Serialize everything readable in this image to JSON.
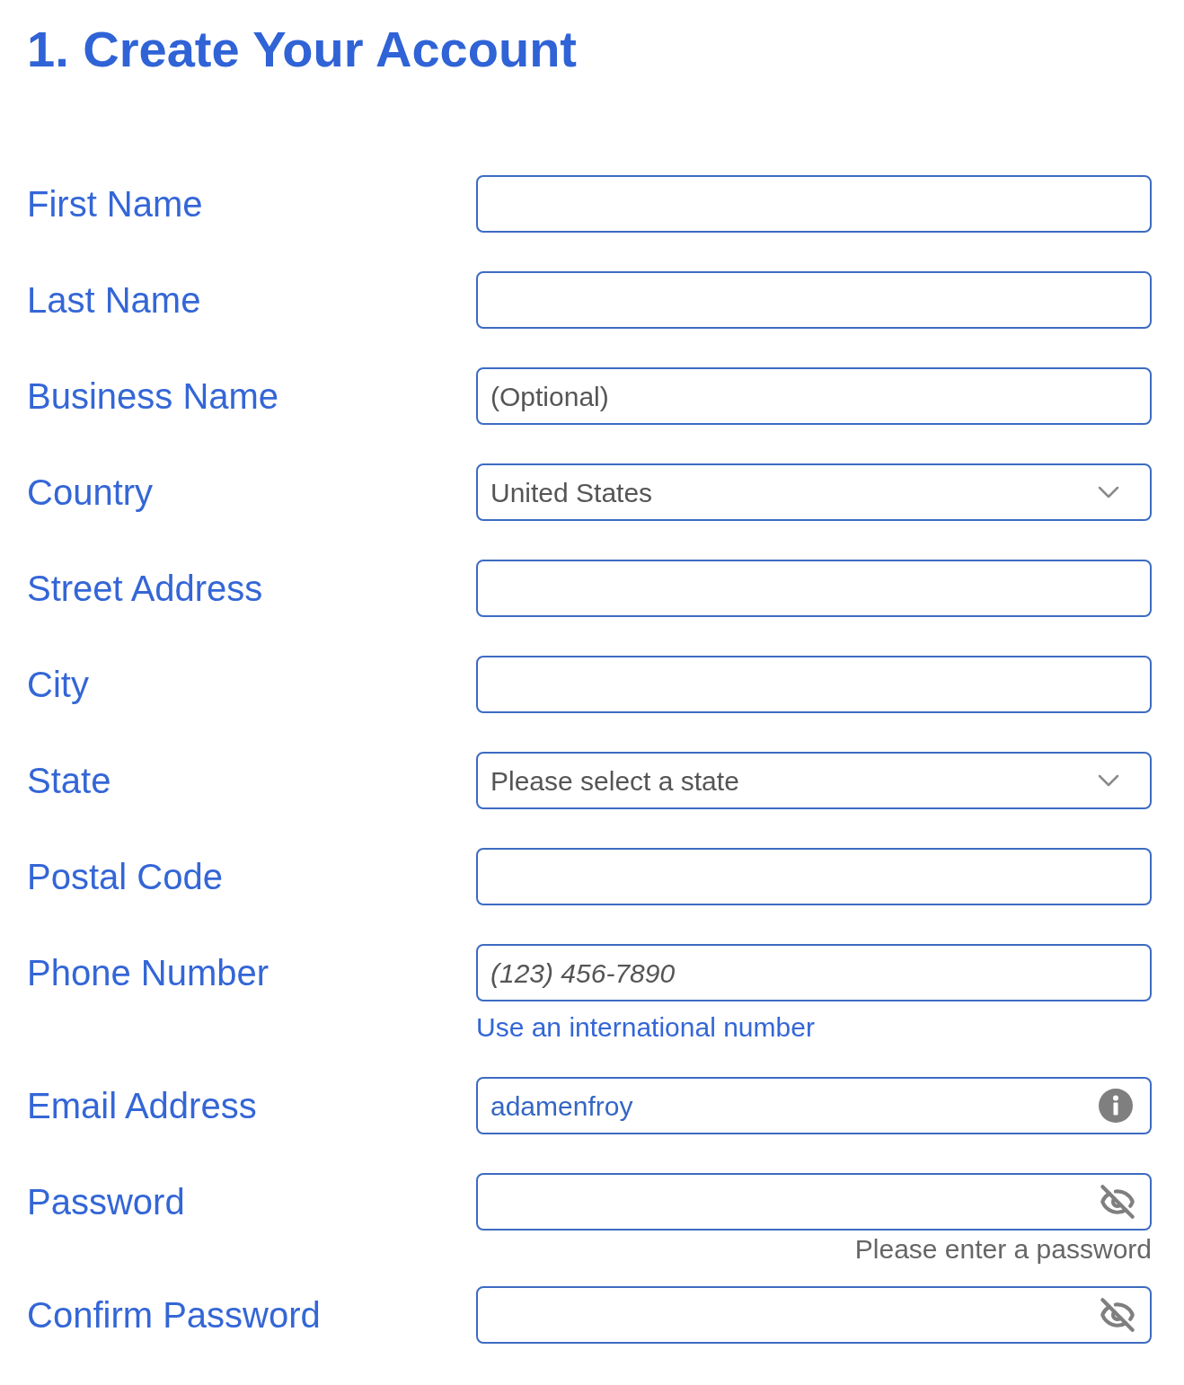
{
  "title": "1. Create Your Account",
  "fields": [
    {
      "label": "First Name",
      "kind": "text"
    },
    {
      "label": "Last Name",
      "kind": "text"
    },
    {
      "label": "Business Name",
      "kind": "text",
      "placeholder": "(Optional)"
    },
    {
      "label": "Country",
      "kind": "select",
      "value": "United States"
    },
    {
      "label": "Street Address",
      "kind": "text"
    },
    {
      "label": "City",
      "kind": "text"
    },
    {
      "label": "State",
      "kind": "select",
      "value": "Please select a state"
    },
    {
      "label": "Postal Code",
      "kind": "text"
    },
    {
      "label": "Phone Number",
      "kind": "phone",
      "placeholder": "(123) 456-7890",
      "helper": {
        "kind": "link",
        "text": "Use an international number"
      }
    },
    {
      "label": "Email Address",
      "kind": "email",
      "value": "adamenfroy"
    },
    {
      "label": "Password",
      "kind": "password",
      "helper": {
        "kind": "hint",
        "text": "Please enter a password"
      }
    },
    {
      "label": "Confirm Password",
      "kind": "password"
    }
  ]
}
